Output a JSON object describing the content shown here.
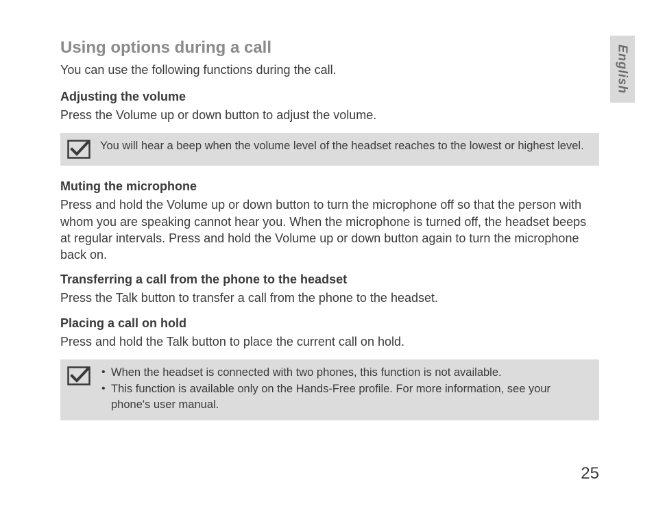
{
  "language_tab": "English",
  "title": "Using options during a call",
  "intro": "You can use the following functions during the call.",
  "sections": {
    "volume": {
      "heading": "Adjusting the volume",
      "body": "Press the Volume up or down button to adjust the volume.",
      "note": "You will hear a beep when the volume level of the headset reaches to the lowest or highest level."
    },
    "mute": {
      "heading": "Muting the microphone",
      "body": "Press and hold the Volume up or down button to turn the microphone off so that the person with whom you are speaking cannot hear you. When the microphone is turned off, the headset beeps at regular intervals. Press and hold the Volume up or down button again to turn the microphone back on."
    },
    "transfer": {
      "heading": "Transferring a call from the phone to the headset",
      "body": "Press the Talk button to transfer a call from the phone to the headset."
    },
    "hold": {
      "heading": "Placing a call on hold",
      "body": "Press and hold the Talk button to place the current call on hold.",
      "notes": [
        "When the headset is connected with two phones, this function is not available.",
        "This function is available only on the Hands-Free profile. For more information, see your phone's user manual."
      ]
    }
  },
  "page_number": "25"
}
